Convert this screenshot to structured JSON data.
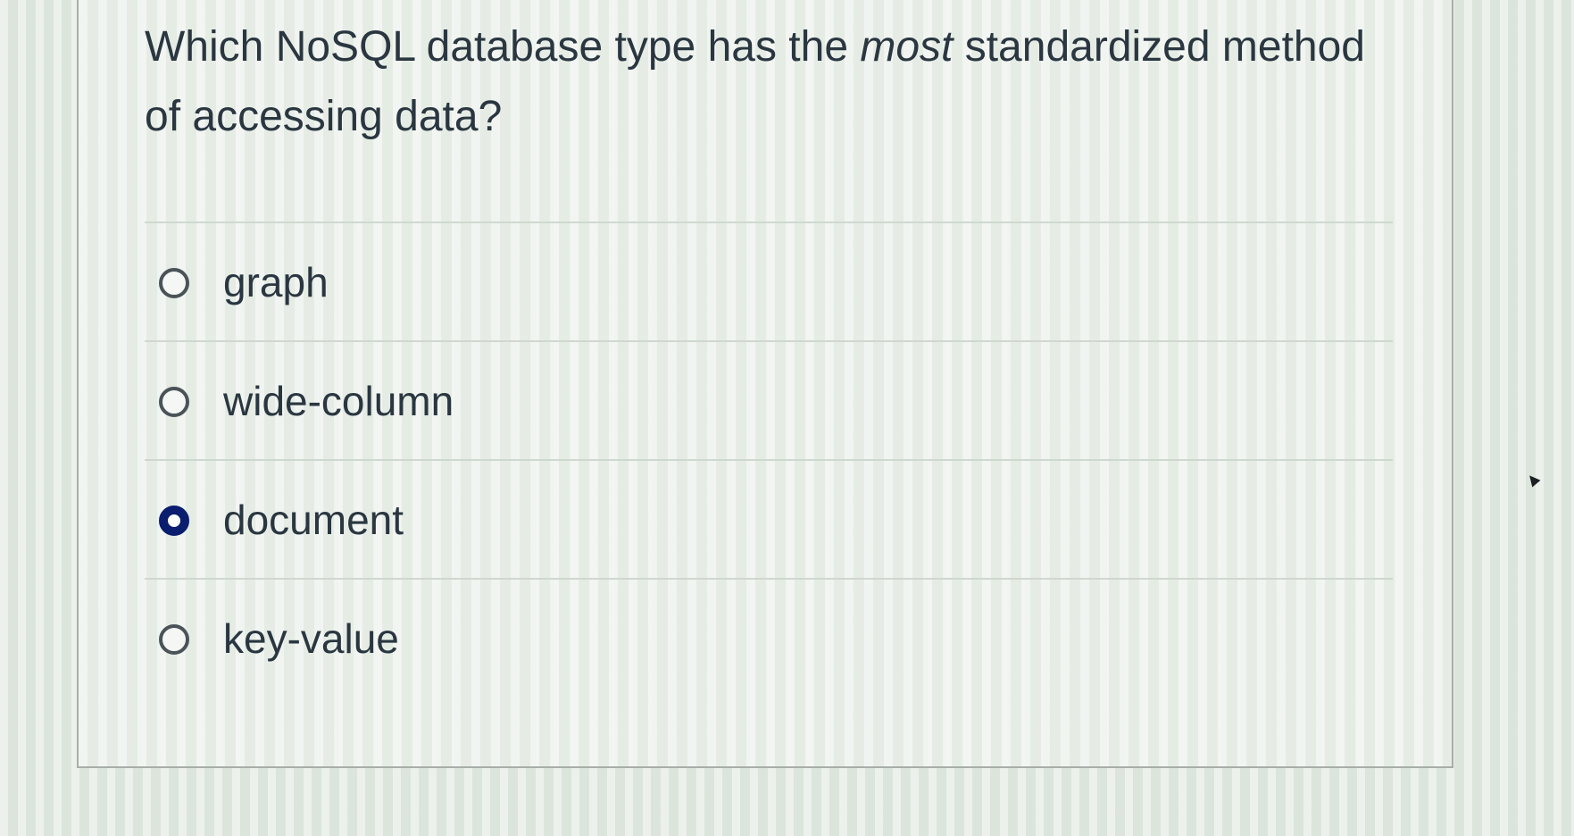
{
  "question": {
    "text_before": "Which NoSQL database type has the ",
    "emphasis": "most",
    "text_after": " standardized method of accessing data?"
  },
  "options": [
    {
      "label": "graph",
      "selected": false
    },
    {
      "label": "wide-column",
      "selected": false
    },
    {
      "label": "document",
      "selected": true
    },
    {
      "label": "key-value",
      "selected": false
    }
  ],
  "colors": {
    "selected_radio": "#0b1d6e",
    "text": "#2a3640",
    "divider": "#cfd8cf"
  }
}
